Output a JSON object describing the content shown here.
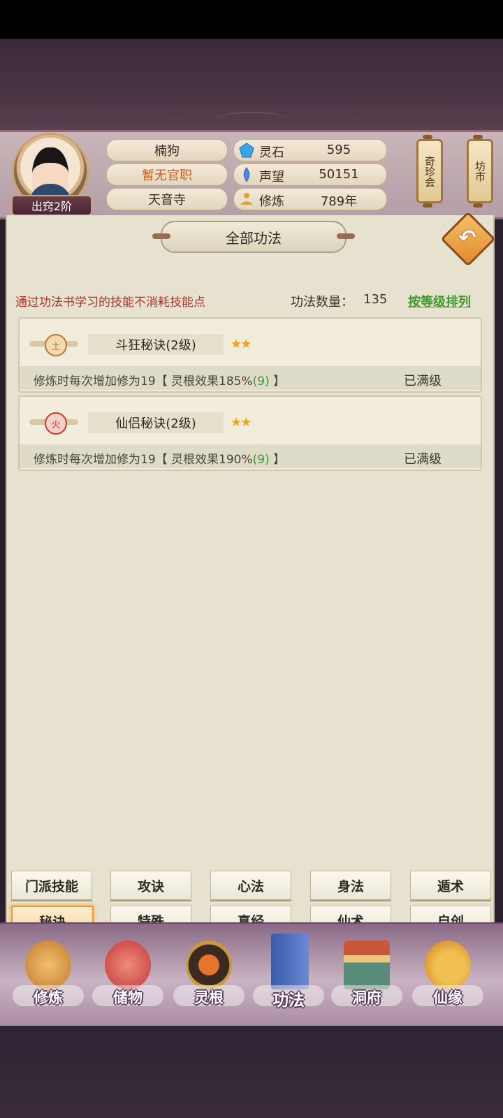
{
  "header": {
    "player_name": "楠狗",
    "official_title": "暂无官职",
    "sect": "天音寺",
    "rank": "出窍2阶",
    "resources": [
      {
        "icon": "spirit-stone-icon",
        "label": "灵石",
        "value": "595"
      },
      {
        "icon": "reputation-icon",
        "label": "声望",
        "value": "50151"
      },
      {
        "icon": "cultivation-icon",
        "label": "修炼",
        "value": "789年"
      }
    ],
    "side_buttons": [
      {
        "label": "奇珍会"
      },
      {
        "label": "坊市"
      }
    ]
  },
  "panel": {
    "title": "全部功法",
    "notice": "通过功法书学习的技能不消耗技能点",
    "count_label": "功法数量：",
    "count_value": "135",
    "sort_label": "按等级排列"
  },
  "skills": [
    {
      "element": "土",
      "element_color": "#b87a3a",
      "name": "斗狂秘诀(2级)",
      "stars": "★★",
      "desc_prefix": "修炼时每次增加修为19【 灵根效果185%",
      "desc_highlight": "(9)",
      "desc_suffix": " 】",
      "status": "已满级"
    },
    {
      "element": "火",
      "element_color": "#c83a32",
      "name": "仙侣秘诀(2级)",
      "stars": "★★",
      "desc_prefix": "修炼时每次增加修为19【 灵根效果190%",
      "desc_highlight": "(9)",
      "desc_suffix": " 】",
      "status": "已满级"
    }
  ],
  "tabs": [
    {
      "label": "门派技能",
      "active": false
    },
    {
      "label": "攻诀",
      "active": false
    },
    {
      "label": "心法",
      "active": false
    },
    {
      "label": "身法",
      "active": false
    },
    {
      "label": "遁术",
      "active": false
    },
    {
      "label": "秘诀",
      "active": true
    },
    {
      "label": "特殊",
      "active": false
    },
    {
      "label": "真经",
      "active": false
    },
    {
      "label": "仙术",
      "active": false
    },
    {
      "label": "自创",
      "active": false
    }
  ],
  "bottom_nav": [
    {
      "label": "修炼",
      "icon": "meditating-monk-icon"
    },
    {
      "label": "储物",
      "icon": "storage-bag-icon"
    },
    {
      "label": "灵根",
      "icon": "spirit-root-icon"
    },
    {
      "label": "功法",
      "icon": "book-icon"
    },
    {
      "label": "洞府",
      "icon": "cave-palace-icon"
    },
    {
      "label": "仙缘",
      "icon": "gourd-icon"
    }
  ],
  "colors": {
    "notice_red": "#b0322b",
    "link_green": "#3c9a2a",
    "active_tab_orange": "#f39a2a",
    "star_gold": "#f0a21c"
  }
}
